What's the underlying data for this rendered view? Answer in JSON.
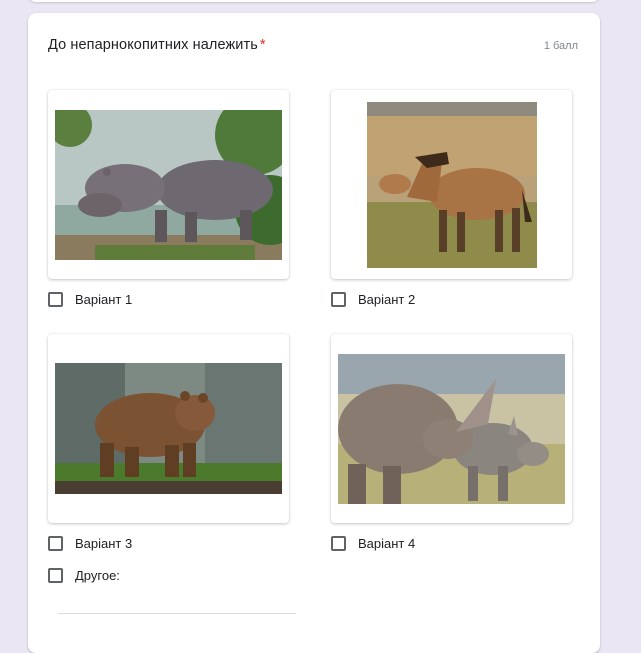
{
  "question": {
    "title": "До непарнокопитних належить",
    "required_mark": "*",
    "points": "1 балл"
  },
  "options": [
    {
      "label": "Варіант 1",
      "image": "hippopotamus-photo"
    },
    {
      "label": "Варіант 2",
      "image": "przewalski-horse-photo"
    },
    {
      "label": "Варіант 3",
      "image": "brown-bear-photo"
    },
    {
      "label": "Варіант 4",
      "image": "rhinoceros-photo"
    }
  ],
  "other_option": {
    "label": "Другое:",
    "value": ""
  },
  "colors": {
    "page_background": "#ebe6f3",
    "required": "#d93025",
    "text": "#202124",
    "muted": "#80868b"
  }
}
